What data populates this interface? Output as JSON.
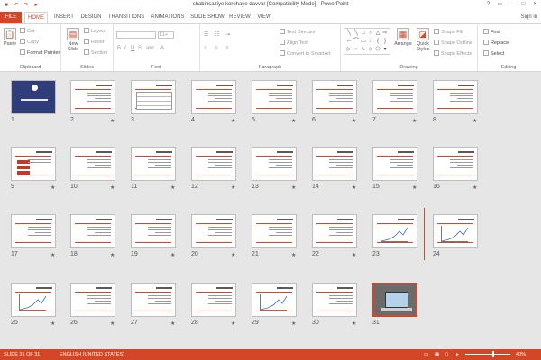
{
  "window": {
    "title": "shabihsaziye korehaye davvar [Compatibility Mode] - PowerPoint",
    "controls": [
      "?",
      "▭",
      "–",
      "□",
      "✕"
    ]
  },
  "qat": [
    "save-icon",
    "undo-icon",
    "redo-icon",
    "present-icon"
  ],
  "tabs": [
    "FILE",
    "HOME",
    "INSERT",
    "DESIGN",
    "TRANSITIONS",
    "ANIMATIONS",
    "SLIDE SHOW",
    "REVIEW",
    "VIEW"
  ],
  "active_tab": "HOME",
  "signin": "Sign in",
  "ribbon": {
    "clipboard": {
      "label": "Clipboard",
      "paste": "Paste",
      "cut": "Cut",
      "copy": "Copy",
      "format_painter": "Format Painter"
    },
    "slides": {
      "label": "Slides",
      "new_slide": "New Slide",
      "layout": "Layout",
      "reset": "Reset",
      "section": "Section"
    },
    "font": {
      "label": "Font",
      "size": "11+"
    },
    "paragraph": {
      "label": "Paragraph",
      "text_direction": "Text Direction",
      "align_text": "Align Text",
      "convert": "Convert to SmartArt"
    },
    "drawing": {
      "label": "Drawing",
      "arrange": "Arrange",
      "quick_styles": "Quick Styles",
      "shape_fill": "Shape Fill",
      "shape_outline": "Shape Outline",
      "shape_effects": "Shape Effects"
    },
    "editing": {
      "label": "Editing",
      "find": "Find",
      "replace": "Replace",
      "select": "Select"
    }
  },
  "slides": [
    {
      "n": "1",
      "kind": "cover",
      "star": false
    },
    {
      "n": "2",
      "kind": "text",
      "star": true
    },
    {
      "n": "3",
      "kind": "table",
      "star": false
    },
    {
      "n": "4",
      "kind": "text",
      "star": true
    },
    {
      "n": "5",
      "kind": "text",
      "star": true
    },
    {
      "n": "6",
      "kind": "text",
      "star": true
    },
    {
      "n": "7",
      "kind": "text",
      "star": true
    },
    {
      "n": "8",
      "kind": "text",
      "star": true
    },
    {
      "n": "9",
      "kind": "boxes",
      "star": true
    },
    {
      "n": "10",
      "kind": "text",
      "star": true
    },
    {
      "n": "11",
      "kind": "text",
      "star": true
    },
    {
      "n": "12",
      "kind": "text",
      "star": true
    },
    {
      "n": "13",
      "kind": "text",
      "star": true
    },
    {
      "n": "14",
      "kind": "text",
      "star": true
    },
    {
      "n": "15",
      "kind": "text",
      "star": true
    },
    {
      "n": "16",
      "kind": "text",
      "star": true
    },
    {
      "n": "17",
      "kind": "text",
      "star": true
    },
    {
      "n": "18",
      "kind": "text",
      "star": true
    },
    {
      "n": "19",
      "kind": "text",
      "star": true
    },
    {
      "n": "20",
      "kind": "text",
      "star": true
    },
    {
      "n": "21",
      "kind": "text",
      "star": true
    },
    {
      "n": "22",
      "kind": "text",
      "star": true
    },
    {
      "n": "23",
      "kind": "plot",
      "star": false
    },
    {
      "n": "24",
      "kind": "plot",
      "star": false
    },
    {
      "n": "25",
      "kind": "plot",
      "star": true
    },
    {
      "n": "26",
      "kind": "text",
      "star": true
    },
    {
      "n": "27",
      "kind": "text",
      "star": true
    },
    {
      "n": "28",
      "kind": "text",
      "star": true
    },
    {
      "n": "29",
      "kind": "plot",
      "star": true
    },
    {
      "n": "30",
      "kind": "text",
      "star": true
    },
    {
      "n": "31",
      "kind": "photo",
      "star": false
    }
  ],
  "star_symbol": "★",
  "status": {
    "slide_info": "SLIDE 31 OF 31",
    "language": "ENGLISH (UNITED STATES)",
    "zoom": "40%"
  }
}
